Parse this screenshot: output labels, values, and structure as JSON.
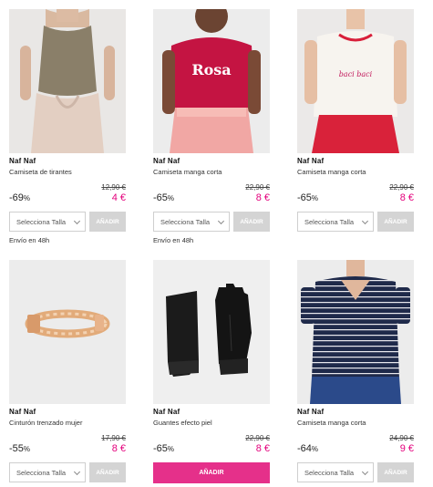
{
  "products": [
    {
      "brand": "Naf Naf",
      "name": "Camiseta de tirantes",
      "discount": "-69",
      "pct": "%",
      "old_price": "12,90 €",
      "new_price": "4 €",
      "select_placeholder": "Selecciona Talla",
      "add_label": "AÑADIR",
      "shipping": "Envío en 48h"
    },
    {
      "brand": "Naf Naf",
      "name": "Camiseta manga corta",
      "discount": "-65",
      "pct": "%",
      "old_price": "22,90 €",
      "new_price": "8 €",
      "select_placeholder": "Selecciona Talla",
      "add_label": "AÑADIR",
      "shipping": "Envío en 48h",
      "print_text": "Rosa"
    },
    {
      "brand": "Naf Naf",
      "name": "Camiseta manga corta",
      "discount": "-65",
      "pct": "%",
      "old_price": "22,90 €",
      "new_price": "8 €",
      "select_placeholder": "Selecciona Talla",
      "add_label": "AÑADIR",
      "print_text": "baci baci"
    },
    {
      "brand": "Naf Naf",
      "name": "Cinturón trenzado mujer",
      "discount": "-55",
      "pct": "%",
      "old_price": "17,90 €",
      "new_price": "8 €",
      "select_placeholder": "Selecciona Talla",
      "add_label": "AÑADIR"
    },
    {
      "brand": "Naf Naf",
      "name": "Guantes efecto piel",
      "discount": "-65",
      "pct": "%",
      "old_price": "22,90 €",
      "new_price": "8 €",
      "add_label": "AÑADIR"
    },
    {
      "brand": "Naf Naf",
      "name": "Camiseta manga corta",
      "discount": "-64",
      "pct": "%",
      "old_price": "24,90 €",
      "new_price": "9 €",
      "select_placeholder": "Selecciona Talla",
      "add_label": "AÑADIR"
    }
  ],
  "colors": {
    "accent": "#e4007c",
    "add_button_pink": "#e5308a",
    "add_button_disabled": "#d4d4d4"
  }
}
